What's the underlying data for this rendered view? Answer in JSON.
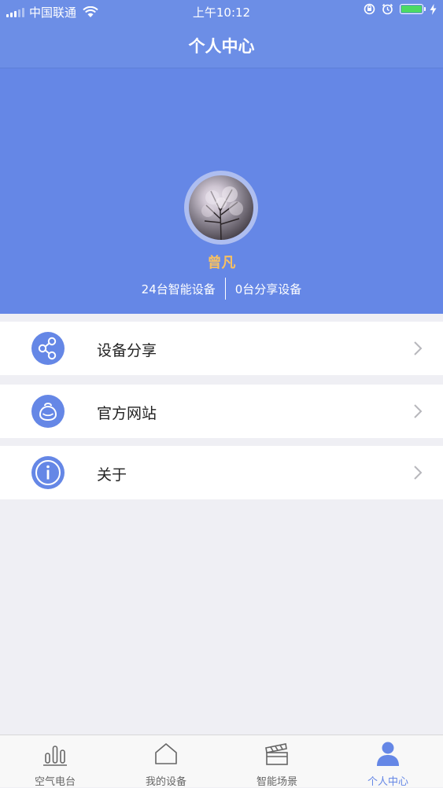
{
  "status_bar": {
    "carrier": "中国联通",
    "time": "上午10:12"
  },
  "header": {
    "title": "个人中心"
  },
  "profile": {
    "name": "曾凡",
    "devices_stat": "24台智能设备",
    "shared_stat": "0台分享设备",
    "name_color": "#f7c062"
  },
  "menu": {
    "items": [
      {
        "label": "设备分享",
        "icon": "share-icon"
      },
      {
        "label": "官方网站",
        "icon": "website-icon"
      },
      {
        "label": "关于",
        "icon": "info-icon"
      }
    ]
  },
  "tab_bar": {
    "tabs": [
      {
        "label": "空气电台",
        "icon": "bar-chart-icon"
      },
      {
        "label": "我的设备",
        "icon": "home-icon"
      },
      {
        "label": "智能场景",
        "icon": "clapperboard-icon"
      },
      {
        "label": "个人中心",
        "icon": "user-icon",
        "active": true
      }
    ]
  },
  "colors": {
    "accent": "#6587e6",
    "header": "#6c8ee6",
    "battery": "#4cd964"
  }
}
